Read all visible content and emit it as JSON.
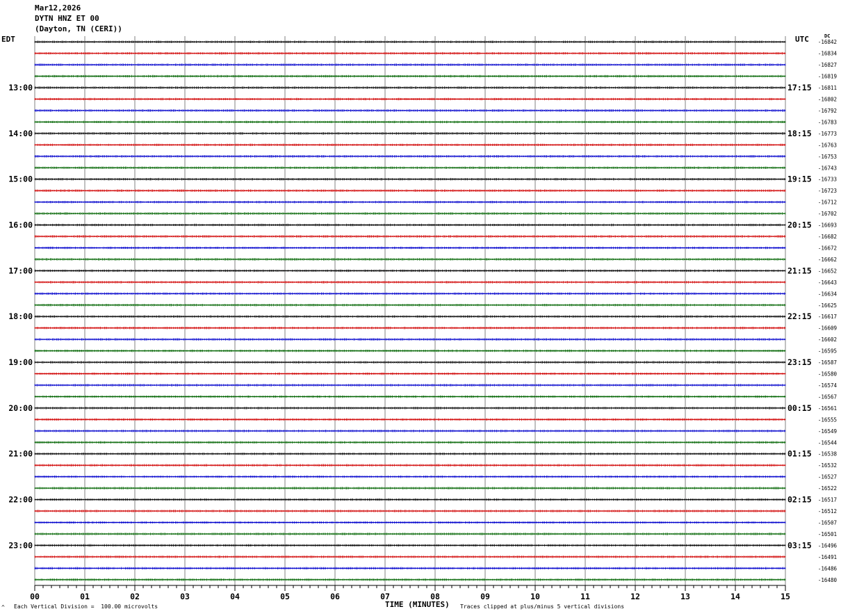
{
  "header": {
    "date": "Mar12,2026",
    "station": "DYTN HNZ ET 00",
    "location": "(Dayton, TN (CERI))"
  },
  "left_timezone": "EDT",
  "right_timezone": "UTC",
  "dc_label": "DC",
  "footer": {
    "scale_note": "Each Vertical Division =  100.00 microvolts",
    "x_title": "TIME (MINUTES)",
    "clip_note": "Traces clipped at plus/minus 5 vertical divisions",
    "corner_mark": "^"
  },
  "colors": {
    "black": "#000000",
    "red": "#d00000",
    "blue": "#0000cc",
    "green": "#006400",
    "grid": "#808080"
  },
  "chart_data": {
    "type": "line",
    "title": "DYTN HNZ ET 00",
    "xlabel": "TIME (MINUTES)",
    "xlim": [
      0,
      15
    ],
    "x_ticks": [
      "00",
      "01",
      "02",
      "03",
      "04",
      "05",
      "06",
      "07",
      "08",
      "09",
      "10",
      "11",
      "12",
      "13",
      "14",
      "15"
    ],
    "trace_colors": [
      "black",
      "red",
      "blue",
      "green"
    ],
    "left_hour_labels": [
      "13:00",
      "14:00",
      "15:00",
      "16:00",
      "17:00",
      "18:00",
      "19:00",
      "20:00",
      "21:00",
      "22:00",
      "23:00"
    ],
    "right_hour_labels": [
      "17:15",
      "18:15",
      "19:15",
      "20:15",
      "21:15",
      "22:15",
      "23:15",
      "00:15",
      "01:15",
      "02:15",
      "03:15"
    ],
    "dc_offsets": [
      -16842,
      -16834,
      -16827,
      -16819,
      -16811,
      -16802,
      -16792,
      -16783,
      -16773,
      -16763,
      -16753,
      -16743,
      -16733,
      -16723,
      -16712,
      -16702,
      -16693,
      -16682,
      -16672,
      -16662,
      -16652,
      -16643,
      -16634,
      -16625,
      -16617,
      -16609,
      -16602,
      -16595,
      -16587,
      -16580,
      -16574,
      -16567,
      -16561,
      -16555,
      -16549,
      -16544,
      -16538,
      -16532,
      -16527,
      -16522,
      -16517,
      -16512,
      -16507,
      -16501,
      -16496,
      -16491,
      -16486,
      -16480
    ],
    "grid": true
  }
}
